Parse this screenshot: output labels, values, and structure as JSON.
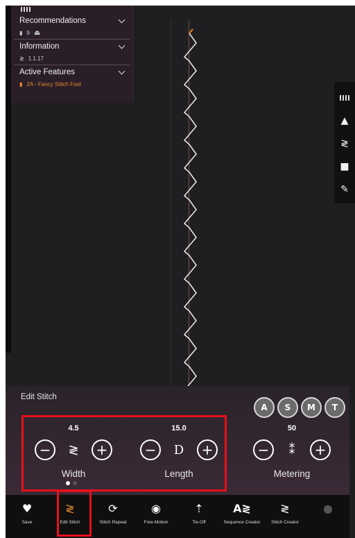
{
  "info_panel": {
    "recommendations": {
      "title": "Recommendations",
      "row_value": "9"
    },
    "information": {
      "title": "Information",
      "row_value": "1.1.17"
    },
    "active_features": {
      "title": "Active Features",
      "row_value": "2A - Fancy Stitch Foot"
    },
    "accent": "#e68a2e"
  },
  "right_toolbar": [
    "grip-icon",
    "presser-foot-icon",
    "stitch-icon",
    "folder-icon",
    "wrench-icon"
  ],
  "edit_stitch": {
    "title": "Edit Stitch",
    "pills": [
      "A",
      "S",
      "M",
      "T"
    ],
    "width": {
      "value": "4.5",
      "label": "Width",
      "minus": "−",
      "plus": "+"
    },
    "length": {
      "value": "15.0",
      "label": "Length",
      "minus": "−",
      "plus": "+"
    },
    "metering": {
      "value": "50",
      "label": "Metering",
      "minus": "−",
      "plus": "+"
    }
  },
  "bottom_nav": {
    "items": [
      {
        "label": "Save",
        "icon": "heart-icon"
      },
      {
        "label": "Edit Stitch",
        "icon": "edit-stitch-icon"
      },
      {
        "label": "Stitch Repeat",
        "icon": "repeat-icon"
      },
      {
        "label": "Free-Motion",
        "icon": "free-motion-icon"
      },
      {
        "label": "Tie-Off",
        "icon": "tie-off-icon"
      },
      {
        "label": "Sequence Creator",
        "icon": "sequence-icon"
      },
      {
        "label": "Stitch Creator",
        "icon": "stitch-creator-icon"
      },
      {
        "label": "",
        "icon": "disabled-icon"
      }
    ]
  },
  "highlight_color": "#e8101a"
}
